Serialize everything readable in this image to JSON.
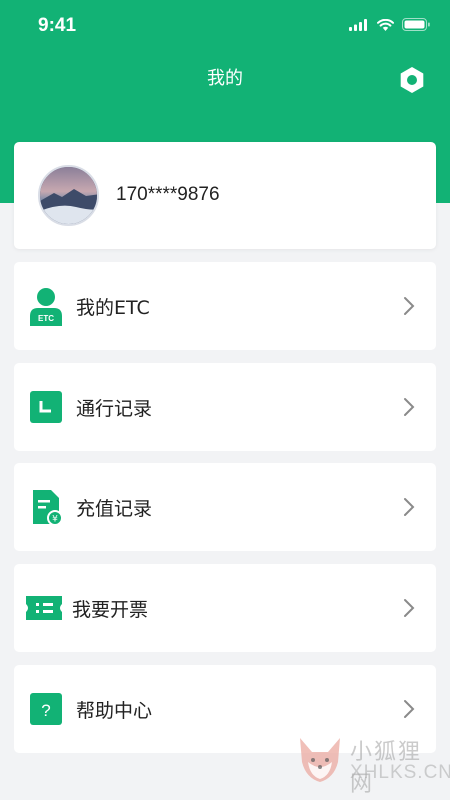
{
  "status_bar": {
    "time": "9:41"
  },
  "nav": {
    "title": "我的"
  },
  "profile": {
    "phone": "170****9876"
  },
  "menu": [
    {
      "label": "我的ETC",
      "icon": "etc-user-icon",
      "icon_text": "ETC"
    },
    {
      "label": "通行记录",
      "icon": "pass-record-icon"
    },
    {
      "label": "充值记录",
      "icon": "recharge-record-icon"
    },
    {
      "label": "我要开票",
      "icon": "invoice-ticket-icon"
    },
    {
      "label": "帮助中心",
      "icon": "help-icon",
      "icon_text": "?"
    }
  ],
  "watermark": {
    "text": "小狐狸网",
    "sub": "XHLKS.CN"
  },
  "colors": {
    "brand": "#12b275",
    "background": "#f2f3f5"
  }
}
